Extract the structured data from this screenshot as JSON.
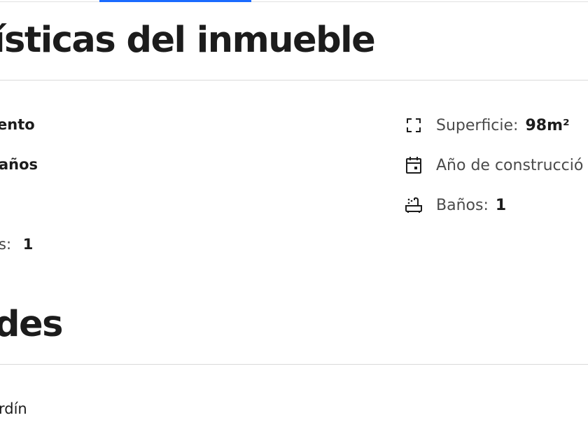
{
  "tabs": {
    "active_indicator_color": "#1b6bff"
  },
  "characteristics": {
    "title": "ísticas del inmueble",
    "left_items": [
      {
        "label": "ento"
      },
      {
        "label": "años"
      },
      {
        "label": "s:",
        "value": "1"
      }
    ],
    "right_items": [
      {
        "icon": "area-icon",
        "label": "Superficie:",
        "value": "98m²"
      },
      {
        "icon": "calendar-icon",
        "label": "Año de construcció",
        "value": ""
      },
      {
        "icon": "bathtub-icon",
        "label": "Baños:",
        "value": "1"
      }
    ]
  },
  "amenities": {
    "title": "des",
    "items": [
      {
        "label": "rdín"
      }
    ]
  }
}
